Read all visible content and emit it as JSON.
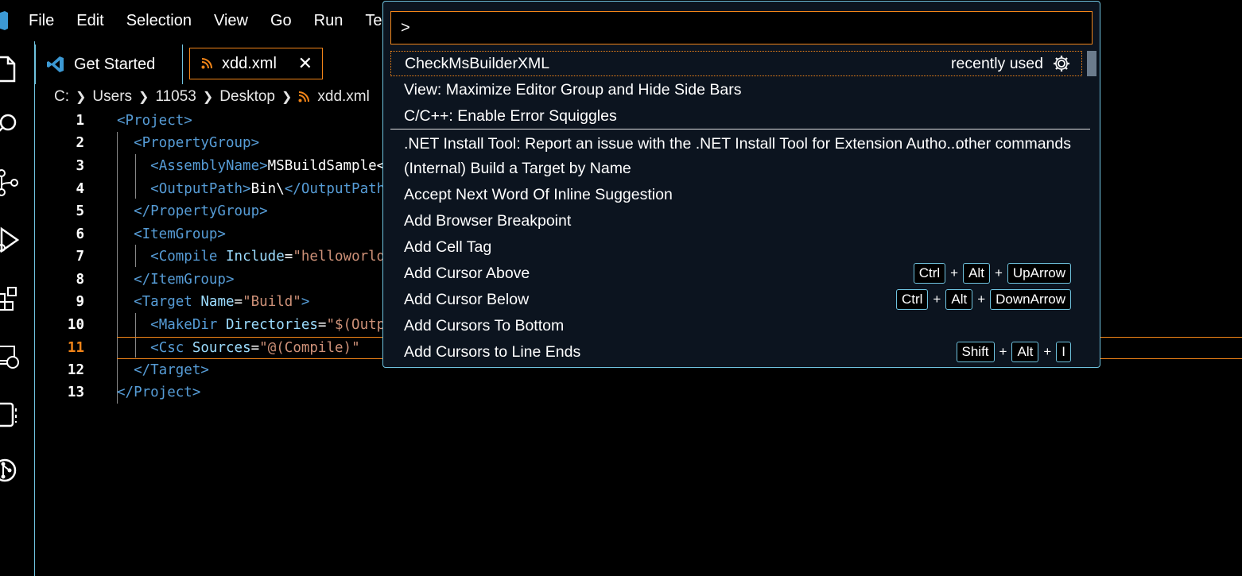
{
  "menu": [
    "File",
    "Edit",
    "Selection",
    "View",
    "Go",
    "Run",
    "Termina"
  ],
  "tabs": {
    "get_started": "Get Started",
    "xdd": "xdd.xml",
    "close": "✕"
  },
  "breadcrumb": [
    "C:",
    "Users",
    "11053",
    "Desktop",
    "xdd.xml"
  ],
  "editor": {
    "line_numbers": [
      "1",
      "2",
      "3",
      "4",
      "5",
      "6",
      "7",
      "8",
      "9",
      "10",
      "11",
      "12",
      "13"
    ]
  },
  "palette": {
    "input_value": ">",
    "recently_used": "recently used",
    "other_commands": "other commands",
    "items": [
      "CheckMsBuilderXML",
      "View: Maximize Editor Group and Hide Side Bars",
      "C/C++: Enable Error Squiggles",
      ".NET Install Tool: Report an issue with the .NET Install Tool for Extension Autho...",
      "(Internal) Build a Target by Name",
      "Accept Next Word Of Inline Suggestion",
      "Add Browser Breakpoint",
      "Add Cell Tag",
      "Add Cursor Above",
      "Add Cursor Below",
      "Add Cursors To Bottom",
      "Add Cursors to Line Ends"
    ],
    "keys": {
      "above": [
        "Ctrl",
        "Alt",
        "UpArrow"
      ],
      "below": [
        "Ctrl",
        "Alt",
        "DownArrow"
      ],
      "line_ends": [
        "Shift",
        "Alt",
        "I"
      ]
    },
    "plus": "+"
  },
  "colors": {
    "accent_orange": "#f38518",
    "border_cyan": "#6fc3df",
    "tag_blue": "#569cd6"
  }
}
